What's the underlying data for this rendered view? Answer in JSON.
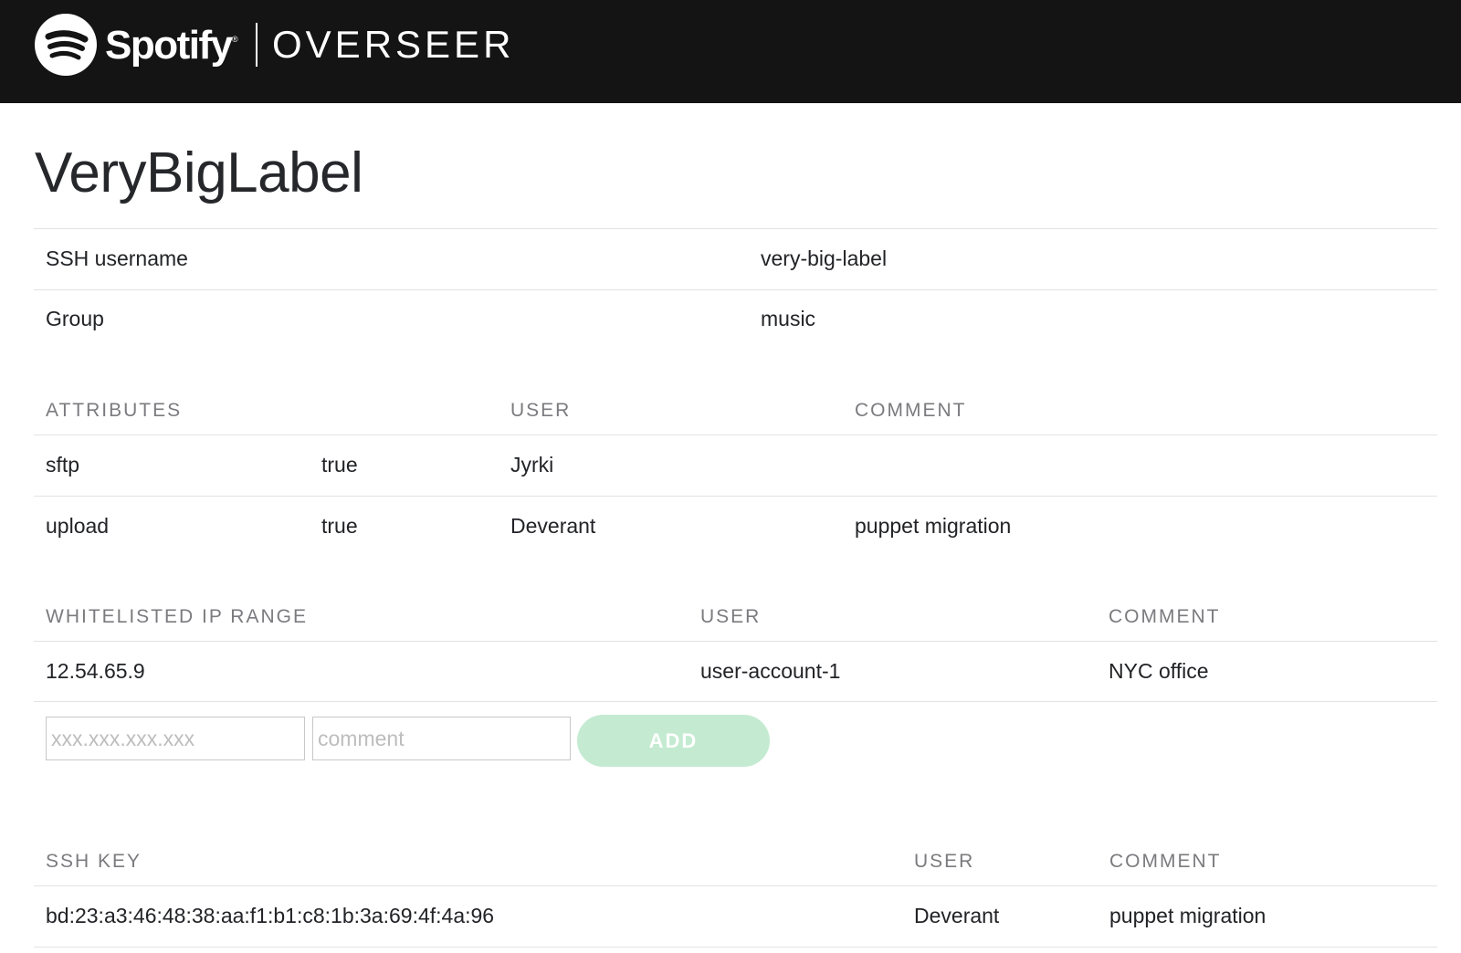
{
  "header": {
    "brand": "Spotify",
    "brand_mark": "®",
    "app_name": "OVERSEER",
    "logo_icon": "spotify-logo-icon"
  },
  "page": {
    "title": "VeryBigLabel"
  },
  "info": [
    {
      "label": "SSH username",
      "value": "very-big-label"
    },
    {
      "label": "Group",
      "value": "music"
    }
  ],
  "attributes": {
    "headers": {
      "attributes": "ATTRIBUTES",
      "user": "USER",
      "comment": "COMMENT"
    },
    "rows": [
      {
        "name": "sftp",
        "value": "true",
        "user": "Jyrki",
        "comment": ""
      },
      {
        "name": "upload",
        "value": "true",
        "user": "Deverant",
        "comment": "puppet migration"
      }
    ]
  },
  "whitelist": {
    "headers": {
      "range": "WHITELISTED IP RANGE",
      "user": "USER",
      "comment": "COMMENT"
    },
    "rows": [
      {
        "ip": "12.54.65.9",
        "user": "user-account-1",
        "comment": "NYC office"
      }
    ],
    "form": {
      "ip_placeholder": "xxx.xxx.xxx.xxx",
      "ip_value": "",
      "comment_placeholder": "comment",
      "comment_value": "",
      "add_label": "ADD"
    }
  },
  "ssh_keys": {
    "headers": {
      "key": "SSH KEY",
      "user": "USER",
      "comment": "COMMENT"
    },
    "rows": [
      {
        "key": "bd:23:a3:46:48:38:aa:f1:b1:c8:1b:3a:69:4f:4a:96",
        "user": "Deverant",
        "comment": "puppet migration"
      }
    ]
  },
  "colors": {
    "topbar": "#141414",
    "add_button": "#c4ebd1",
    "header_text": "#7b7b7f",
    "rule": "#e3e3e3"
  }
}
